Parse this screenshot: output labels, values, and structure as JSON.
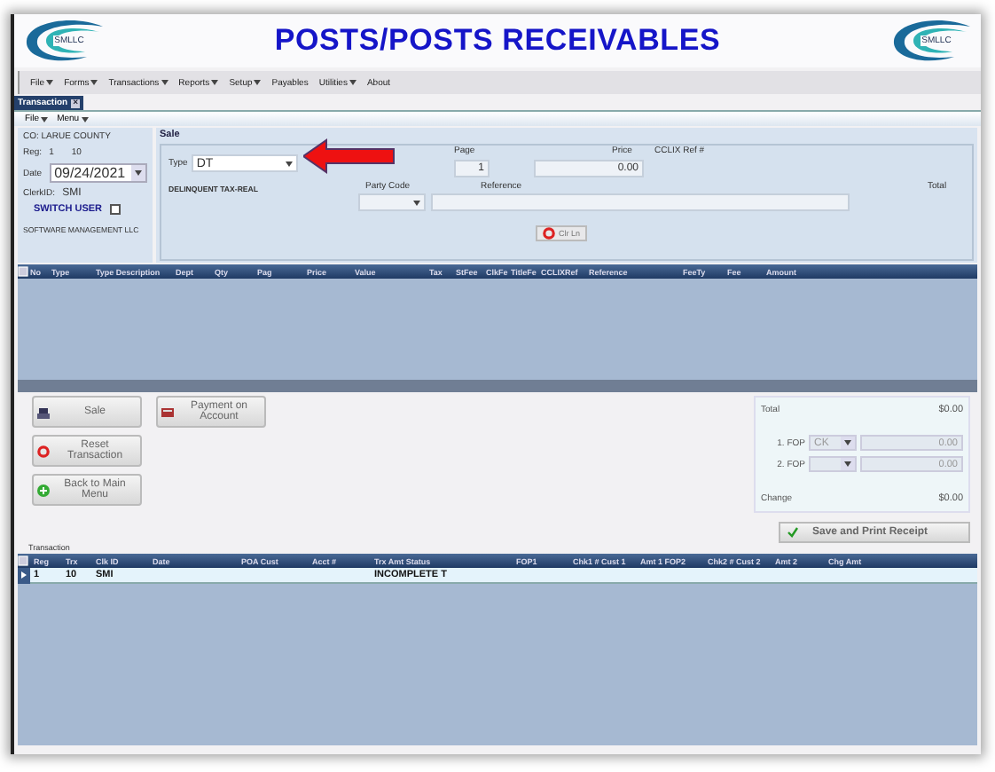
{
  "header": {
    "title": "POSTS/POSTS RECEIVABLES",
    "logo_text": [
      "SMLLC",
      "SMLLC"
    ]
  },
  "menu": [
    {
      "label": "File",
      "dropdown": true
    },
    {
      "label": "Forms",
      "dropdown": true
    },
    {
      "label": "Transactions",
      "dropdown": true
    },
    {
      "label": "Reports",
      "dropdown": true
    },
    {
      "label": "Setup",
      "dropdown": true
    },
    {
      "label": "Payables",
      "dropdown": false
    },
    {
      "label": "Utilities",
      "dropdown": true
    },
    {
      "label": "About",
      "dropdown": false
    }
  ],
  "tab": {
    "label": "Transaction",
    "close": "×"
  },
  "submenu": [
    {
      "label": "File",
      "dropdown": true
    },
    {
      "label": "Menu",
      "dropdown": true
    }
  ],
  "info": {
    "county": "CO:  LARUE COUNTY",
    "reg_label": "Reg:",
    "reg": "1",
    "reg_trx": "10",
    "date_label": "Date",
    "date": "09/24/2021",
    "clerk_label": "ClerkID:",
    "clerk": "SMI",
    "switch_user": "SWITCH USER",
    "switch_checked": false,
    "company": "SOFTWARE MANAGEMENT LLC"
  },
  "sale": {
    "title": "Sale",
    "type_label": "Type",
    "type_value": "DT",
    "type_description": "DELINQUENT TAX-REAL",
    "page_label": "Page",
    "page_value": "1",
    "price_label": "Price",
    "price_value": "0.00",
    "ref_label": "CCLIX Ref #",
    "party_label": "Party Code",
    "reference_label": "Reference",
    "total_label": "Total",
    "clear_button": "Clr Ln"
  },
  "items_table": {
    "columns": [
      "No",
      "Type",
      "Type Description",
      "Dept",
      "Qty",
      "Pag",
      "Price",
      "Value",
      "Tax",
      "StFee",
      "ClkFe",
      "TitleFe",
      "CCLIXRef",
      "Reference",
      "FeeTy",
      "Fee",
      "Amount"
    ]
  },
  "actions": [
    {
      "label": "Sale",
      "kind": "register"
    },
    {
      "label": "Reset Transaction",
      "kind": "reset"
    },
    {
      "label": "Back to Main Menu",
      "kind": "back"
    },
    {
      "label": "Payment on Account",
      "kind": "account"
    }
  ],
  "totals": {
    "total_label": "Total",
    "total": "$0.00",
    "fop": [
      {
        "label": "1. FOP",
        "type": "CK",
        "amount": "0.00"
      },
      {
        "label": "2. FOP",
        "amount": "0.00"
      }
    ],
    "change_label": "Change",
    "change": "$0.00"
  },
  "save_button": "Save and Print Receipt",
  "transactions": {
    "title": "Transaction",
    "columns": [
      "Reg",
      "Trx",
      "Clk ID",
      "Date",
      "POA Cust",
      "Acct #",
      "Trx Amt Status",
      "FOP1",
      "Chk1 # Cust 1",
      "Amt 1 FOP2",
      "Chk2 # Cust 2",
      "Amt 2",
      "Chg Amt"
    ],
    "rows": [
      {
        "cells": [
          "1",
          "10",
          "SMI",
          "",
          "",
          "",
          "INCOMPLETE T",
          "",
          "",
          "",
          "",
          "",
          ""
        ],
        "selected": true
      }
    ]
  }
}
